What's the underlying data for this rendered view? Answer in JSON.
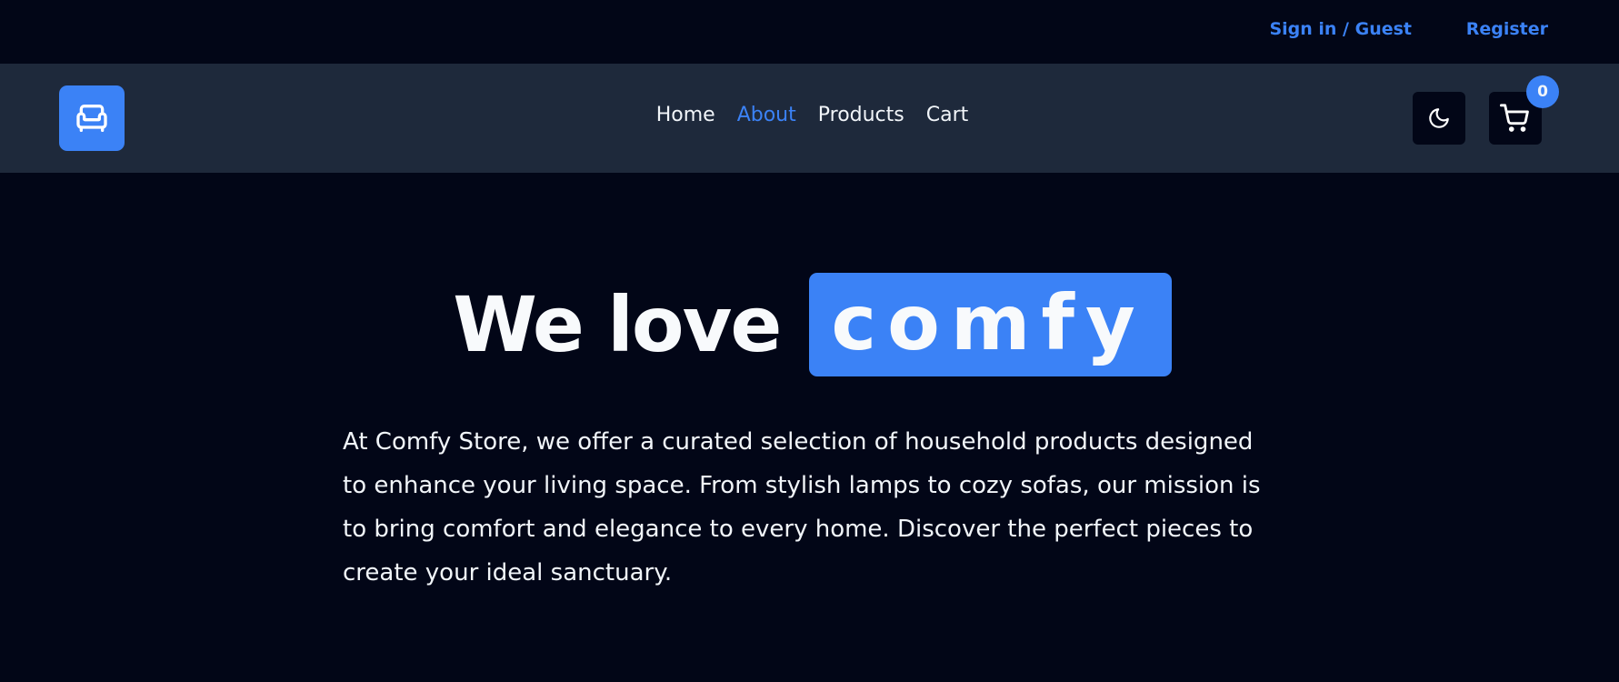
{
  "topbar": {
    "signin_label": "Sign in / Guest",
    "register_label": "Register"
  },
  "navbar": {
    "logo_icon": "armchair-icon",
    "links": [
      {
        "label": "Home",
        "active": false
      },
      {
        "label": "About",
        "active": true
      },
      {
        "label": "Products",
        "active": false
      },
      {
        "label": "Cart",
        "active": false
      }
    ],
    "theme_icon": "moon-icon",
    "cart_icon": "cart-icon",
    "cart_count": "0"
  },
  "hero": {
    "title_lead": "We love",
    "title_highlight": "comfy",
    "description": "At Comfy Store, we offer a curated selection of household products designed to enhance your living space. From stylish lamps to cozy sofas, our mission is to bring comfort and elegance to every home. Discover the perfect pieces to create your ideal sanctuary."
  },
  "colors": {
    "background": "#020617",
    "navbar": "#1e293b",
    "accent": "#3b82f6",
    "text": "#f1f5f9"
  }
}
